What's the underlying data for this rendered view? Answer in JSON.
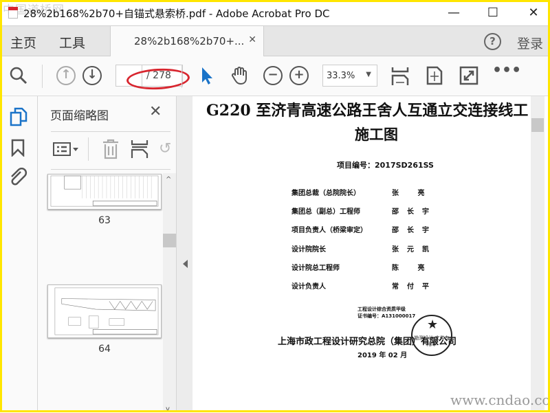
{
  "window": {
    "title": "28%2b168%2b70+自锚式悬索桥.pdf - Adobe Acrobat Pro DC",
    "watermark_top": "中国道桥网",
    "watermark_bottom": "www.cndao.com"
  },
  "tabs": {
    "home": "主页",
    "tools": "工具",
    "doc_tab": "28%2b168%2b70+...",
    "help": "?",
    "login": "登录"
  },
  "toolbar": {
    "page_current": "",
    "page_total": "/ 278",
    "zoom": "33.3%"
  },
  "panel": {
    "title": "页面缩略图",
    "thumbnails": [
      {
        "page": "63"
      },
      {
        "page": "64"
      }
    ]
  },
  "document": {
    "title": "G220 至济青高速公路王舍人互通立交连接线工",
    "subtitle": "施工图",
    "project_code": "项目编号：2017SD261SS",
    "signatories": [
      {
        "role": "集团总裁（总院院长）",
        "name": "张 亮"
      },
      {
        "role": "集团总（副总）工程师",
        "name": "邵长宇"
      },
      {
        "role": "项目负责人（桥梁审定）",
        "name": "邵长宇"
      },
      {
        "role": "设计院院长",
        "name": "张元凯"
      },
      {
        "role": "设计院总工程师",
        "name": "陈 亮"
      },
      {
        "role": "设计负责人",
        "name": "常付平"
      }
    ],
    "qualification": "工程设计综合资质甲级",
    "certificate": "证书编号：A131000017",
    "company": "上海市政工程设计研究总院（集团）有限公司",
    "date": "2019 年 02 月",
    "stamp_text": "勘测设计 文件专用章"
  }
}
